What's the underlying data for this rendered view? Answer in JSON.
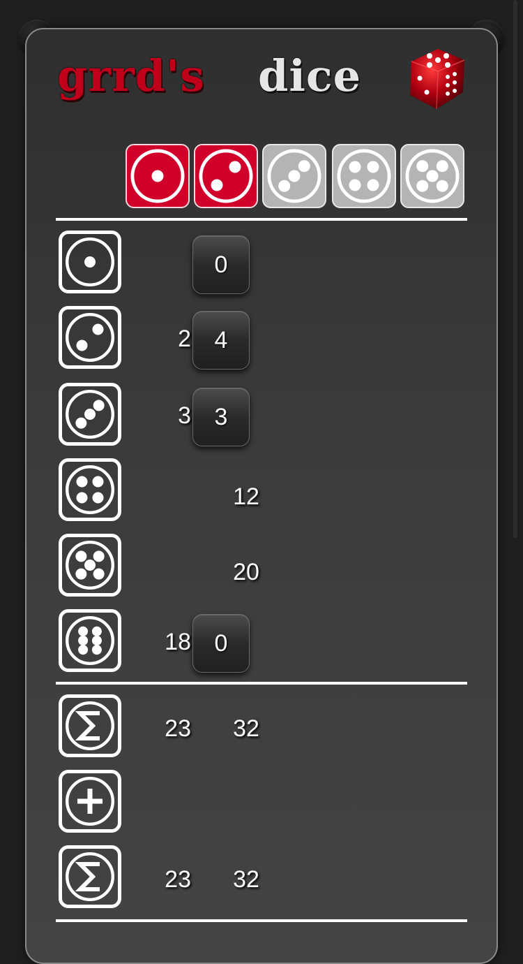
{
  "app": {
    "title_red": "grrd's",
    "title_white": "dice",
    "logo_icon": "red-die-icon"
  },
  "colors": {
    "accent_red": "#d0002a",
    "inactive_gray": "#b4b4b4",
    "panel_bg": "#3b3b3b"
  },
  "dice": [
    {
      "value": 1,
      "held": true
    },
    {
      "value": 2,
      "held": true
    },
    {
      "value": 3,
      "held": false
    },
    {
      "value": 4,
      "held": false
    },
    {
      "value": 5,
      "held": false
    }
  ],
  "rows": [
    {
      "icon": "die-face-1-icon",
      "left": "",
      "button": "0",
      "right": ""
    },
    {
      "icon": "die-face-2-icon",
      "left": "2",
      "button": "4",
      "right": ""
    },
    {
      "icon": "die-face-3-icon",
      "left": "3",
      "button": "3",
      "right": ""
    },
    {
      "icon": "die-face-4-icon",
      "left": "",
      "button": "",
      "right": "12"
    },
    {
      "icon": "die-face-5-icon",
      "left": "",
      "button": "",
      "right": "20"
    },
    {
      "icon": "die-face-6-icon",
      "left": "18",
      "button": "0",
      "right": ""
    }
  ],
  "totals": [
    {
      "icon": "sum-icon",
      "left": "23",
      "right": "32"
    },
    {
      "icon": "plus-icon",
      "left": "",
      "right": ""
    },
    {
      "icon": "sum-icon",
      "left": "23",
      "right": "32"
    }
  ]
}
